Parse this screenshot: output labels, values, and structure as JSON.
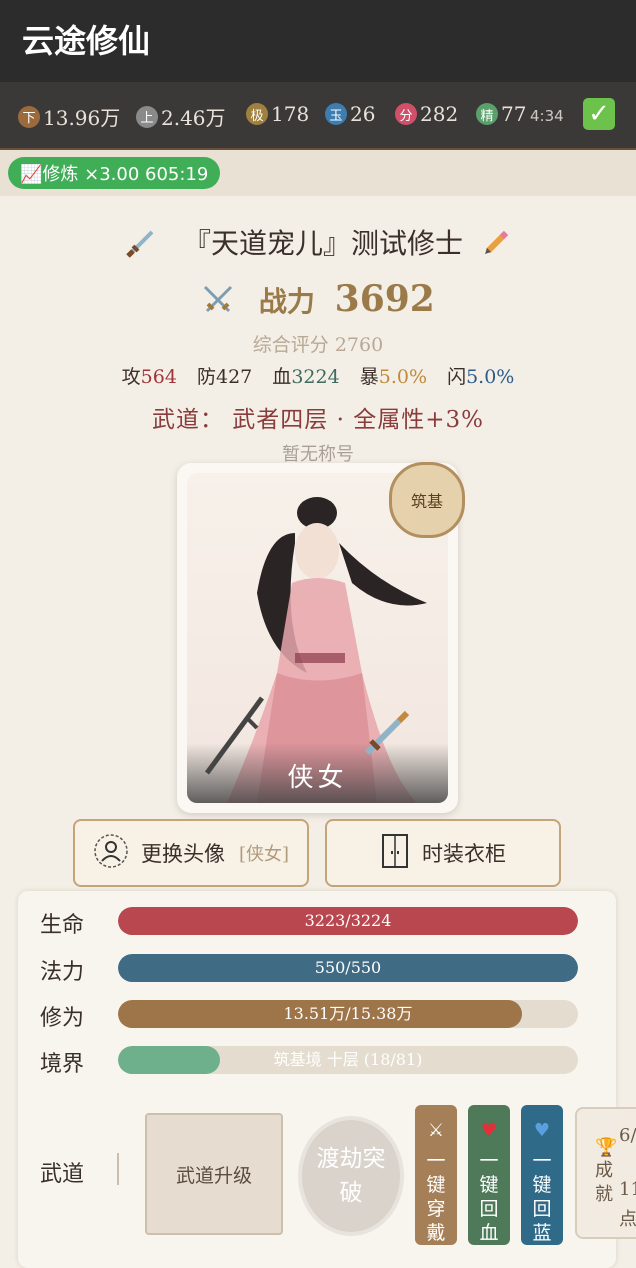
{
  "app": {
    "title": "云途修仙"
  },
  "resources": [
    {
      "badge": "下",
      "value": "13.96万",
      "color": "#9b6b3e"
    },
    {
      "badge": "上",
      "value": "2.46万",
      "color": "#8a8a8a"
    },
    {
      "badge": "极",
      "value": "178",
      "color": "#a0803f"
    },
    {
      "badge": "玉",
      "value": "26",
      "color": "#3d7db0"
    },
    {
      "badge": "分",
      "value": "282",
      "color": "#d0506a"
    },
    {
      "badge": "精",
      "value": "77",
      "color": "#5aa06a"
    }
  ],
  "clock": "4:34",
  "buff": {
    "text": "📈修炼 ×3.00 605:19"
  },
  "character": {
    "title": "『天道宠儿』测试修士",
    "power_label": "战力",
    "power_value": "3692",
    "score": "综合评分 2760",
    "stats": [
      {
        "label": "攻",
        "value": "564",
        "color": "#a0343a"
      },
      {
        "label": "防",
        "value": "427",
        "color": "#3a2f2a"
      },
      {
        "label": "血",
        "value": "3224",
        "color": "#3d6b5e"
      },
      {
        "label": "暴",
        "value": "5.0%",
        "color": "#c08a3a"
      },
      {
        "label": "闪",
        "value": "5.0%",
        "color": "#2c5c8a"
      }
    ],
    "wudao": "武道： 武者四层 · 全属性+3%",
    "no_title": "暂无称号",
    "portrait_name": "侠女",
    "realm_seal": "筑基"
  },
  "buttons": {
    "avatar": "更换头像",
    "avatar_sub": "[侠女]",
    "wardrobe": "时装衣柜"
  },
  "bars": [
    {
      "label": "生命",
      "text": "3223/3224",
      "fraction": 1.0,
      "color": "#b9474f"
    },
    {
      "label": "法力",
      "text": "550/550",
      "fraction": 1.0,
      "color": "#3f6b84"
    },
    {
      "label": "修为",
      "text": "13.51万/15.38万",
      "fraction": 0.878,
      "color": "#9e7548"
    },
    {
      "label": "境界",
      "text": "筑基境 十层 (18/81)",
      "fraction": 0.222,
      "color": "#6fb08c"
    }
  ],
  "wudao_section": {
    "label": "武道",
    "upgrade": "武道升级",
    "dujie": "渡劫突破",
    "equip": "一键穿戴",
    "heal": "一键回血",
    "mana": "一键回蓝",
    "achievement": "成就",
    "ach_progress": "6/",
    "ach_points": "11",
    "ach_points_unit": "点"
  }
}
